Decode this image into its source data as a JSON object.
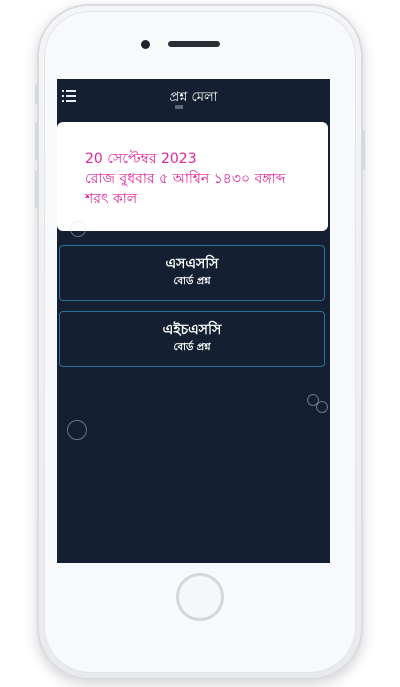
{
  "app": {
    "title": "প্রশ্ন মেলা",
    "menu_icon": "hamburger-menu-icon"
  },
  "date_card": {
    "gregorian": "20 সেপ্টেম্বর 2023",
    "bangla": "রোজ বুধবার ৫ আশ্বিন ১৪৩০ বঙ্গাব্দ",
    "season": "শরৎ কাল",
    "text_color": "#e0249a"
  },
  "exams": [
    {
      "title": "এসএসসি",
      "subtitle": "বোর্ড প্রশ্ন"
    },
    {
      "title": "এইচএসসি",
      "subtitle": "বোর্ড প্রশ্ন"
    }
  ],
  "colors": {
    "screen_bg": "#142032",
    "card_border": "#2e6f99",
    "card_bg": "#ffffff"
  }
}
